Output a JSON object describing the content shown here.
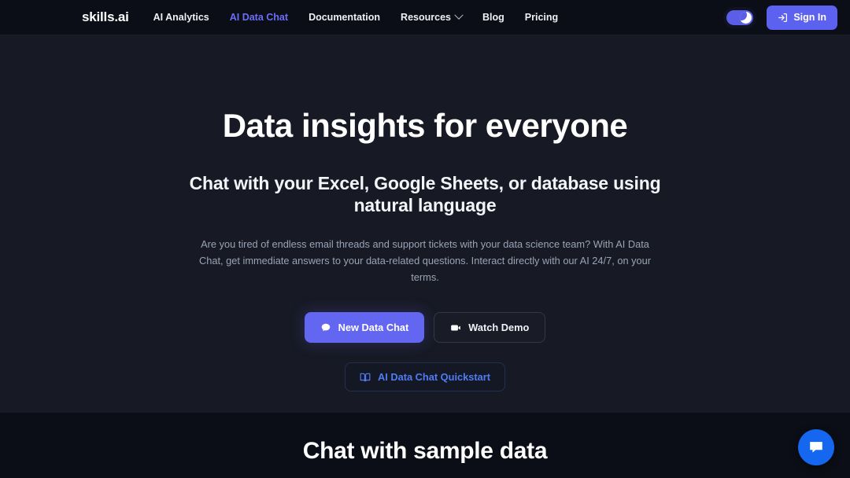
{
  "navbar": {
    "logo": "skills.ai",
    "links": [
      {
        "label": "AI Analytics",
        "active": false,
        "caret": false
      },
      {
        "label": "AI Data Chat",
        "active": true,
        "caret": false
      },
      {
        "label": "Documentation",
        "active": false,
        "caret": false
      },
      {
        "label": "Resources",
        "active": false,
        "caret": true
      },
      {
        "label": "Blog",
        "active": false,
        "caret": false
      },
      {
        "label": "Pricing",
        "active": false,
        "caret": false
      }
    ],
    "theme_toggle": {
      "state": "dark",
      "icon": "moon-icon"
    },
    "signin": {
      "label": "Sign In",
      "icon": "login-arrow-icon"
    }
  },
  "hero": {
    "title": "Data insights for everyone",
    "subtitle": "Chat with your Excel, Google Sheets, or database using natural language",
    "paragraph": "Are you tired of endless email threads and support tickets with your data science team? With AI Data Chat, get immediate answers to your data-related questions. Interact directly with our AI 24/7, on your terms.",
    "primary_cta": {
      "label": "New Data Chat",
      "icon": "chat-bubble-icon"
    },
    "secondary_cta": {
      "label": "Watch Demo",
      "icon": "video-play-icon"
    },
    "quickstart_cta": {
      "label": "AI Data Chat Quickstart",
      "icon": "book-icon"
    }
  },
  "sample_section": {
    "title": "Chat with sample data"
  },
  "chat_widget": {
    "icon": "chat-bubble-icon",
    "color": "#1567ef"
  },
  "colors": {
    "accent_purple": "#6366f1",
    "link_blue": "#4f7cf5",
    "nav_bg": "#0b0e16",
    "hero_bg": "#171a24",
    "widget_blue": "#1567ef"
  }
}
